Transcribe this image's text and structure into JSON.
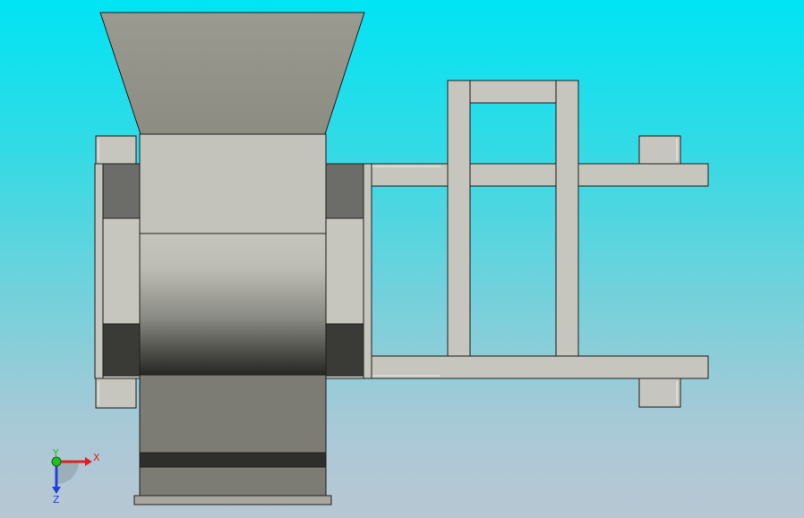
{
  "viewport": {
    "background_top": "#00e4f4",
    "background_bottom": "#b8c7d4"
  },
  "triad": {
    "x_label": "X",
    "y_label": "Y",
    "z_label": "Z",
    "x_color": "#e02020",
    "y_color": "#20c020",
    "z_color": "#2040e0"
  }
}
